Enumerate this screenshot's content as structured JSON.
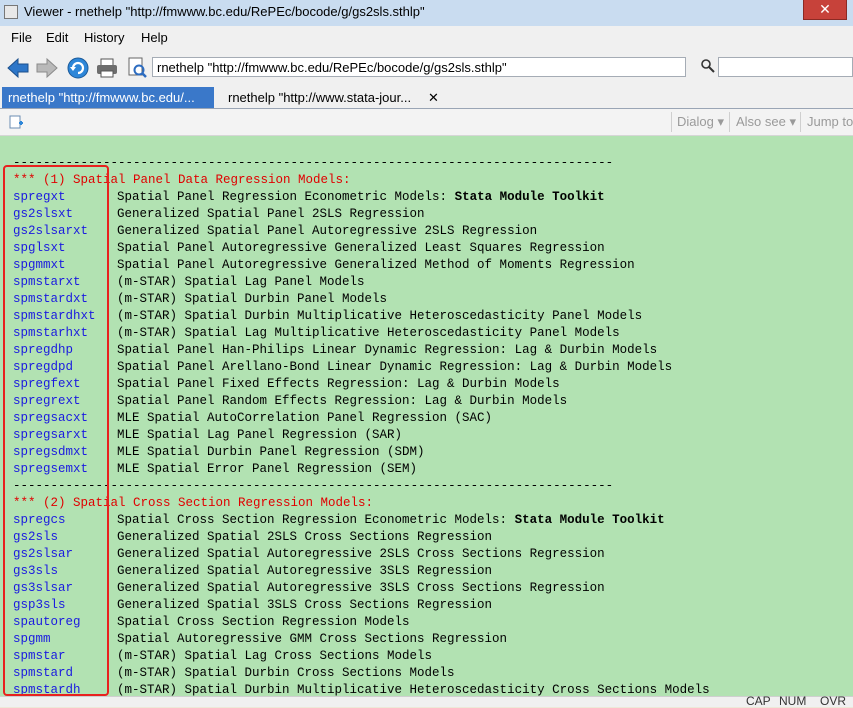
{
  "window": {
    "title": "Viewer - rnethelp \"http://fmwww.bc.edu/RePEc/bocode/g/gs2sls.sthlp\""
  },
  "menu": [
    "File",
    "Edit",
    "History",
    "Help"
  ],
  "toolbar": {
    "address": "rnethelp \"http://fmwww.bc.edu/RePEc/bocode/g/gs2sls.sthlp\""
  },
  "tabs": [
    {
      "label": "rnethelp \"http://fmwww.bc.edu/...",
      "active": true
    },
    {
      "label": "rnethelp \"http://www.stata-jour...",
      "active": false
    }
  ],
  "viewer_controls": {
    "dialog": "Dialog",
    "also_see": "Also see",
    "jump_to": "Jump to"
  },
  "content": {
    "rule": "--------------------------------------------------------------------------------",
    "section1": "*** (1) Spatial Panel Data Regression Models:",
    "section1_rows": [
      {
        "cmd": "spregxt",
        "desc": "Spatial Panel Regression Econometric Models: ",
        "bold": "Stata Module Toolkit"
      },
      {
        "cmd": "gs2slsxt",
        "desc": "Generalized Spatial Panel 2SLS Regression"
      },
      {
        "cmd": "gs2slsarxt",
        "desc": "Generalized Spatial Panel Autoregressive 2SLS Regression"
      },
      {
        "cmd": "spglsxt",
        "desc": "Spatial Panel Autoregressive Generalized Least Squares Regression"
      },
      {
        "cmd": "spgmmxt",
        "desc": "Spatial Panel Autoregressive Generalized Method of Moments Regression"
      },
      {
        "cmd": "spmstarxt",
        "desc": "(m-STAR) Spatial Lag Panel Models"
      },
      {
        "cmd": "spmstardxt",
        "desc": "(m-STAR) Spatial Durbin Panel Models"
      },
      {
        "cmd": "spmstardhxt",
        "desc": "(m-STAR) Spatial Durbin Multiplicative Heteroscedasticity Panel Models"
      },
      {
        "cmd": "spmstarhxt",
        "desc": "(m-STAR) Spatial Lag Multiplicative Heteroscedasticity Panel Models"
      },
      {
        "cmd": "spregdhp",
        "desc": "Spatial Panel Han-Philips Linear Dynamic Regression: Lag & Durbin Models"
      },
      {
        "cmd": "spregdpd",
        "desc": "Spatial Panel Arellano-Bond Linear Dynamic Regression: Lag & Durbin Models"
      },
      {
        "cmd": "spregfext",
        "desc": "Spatial Panel Fixed Effects Regression: Lag & Durbin Models"
      },
      {
        "cmd": "spregrext",
        "desc": "Spatial Panel Random Effects Regression: Lag & Durbin Models"
      },
      {
        "cmd": "spregsacxt",
        "desc": "MLE Spatial AutoCorrelation Panel Regression (SAC)"
      },
      {
        "cmd": "spregsarxt",
        "desc": "MLE Spatial Lag Panel Regression (SAR)"
      },
      {
        "cmd": "spregsdmxt",
        "desc": "MLE Spatial Durbin Panel Regression (SDM)"
      },
      {
        "cmd": "spregsemxt",
        "desc": "MLE Spatial Error Panel Regression (SEM)"
      }
    ],
    "section2": "*** (2) Spatial Cross Section Regression Models:",
    "section2_rows": [
      {
        "cmd": "spregcs",
        "desc": "Spatial Cross Section Regression Econometric Models: ",
        "bold": "Stata Module Toolkit"
      },
      {
        "cmd": "gs2sls",
        "desc": "Generalized Spatial 2SLS Cross Sections Regression"
      },
      {
        "cmd": "gs2slsar",
        "desc": "Generalized Spatial Autoregressive 2SLS Cross Sections Regression"
      },
      {
        "cmd": "gs3sls",
        "desc": "Generalized Spatial Autoregressive 3SLS Regression"
      },
      {
        "cmd": "gs3slsar",
        "desc": "Generalized Spatial Autoregressive 3SLS Cross Sections Regression"
      },
      {
        "cmd": "gsp3sls",
        "desc": "Generalized Spatial 3SLS Cross Sections Regression"
      },
      {
        "cmd": "spautoreg",
        "desc": "Spatial Cross Section Regression Models"
      },
      {
        "cmd": "spgmm",
        "desc": "Spatial Autoregressive GMM Cross Sections Regression"
      },
      {
        "cmd": "spmstar",
        "desc": "(m-STAR) Spatial Lag Cross Sections Models"
      },
      {
        "cmd": "spmstard",
        "desc": "(m-STAR) Spatial Durbin Cross Sections Models"
      },
      {
        "cmd": "spmstardh",
        "desc": "(m-STAR) Spatial Durbin Multiplicative Heteroscedasticity Cross Sections Models"
      }
    ]
  },
  "status": {
    "cap": "CAP",
    "num": "NUM",
    "ovr": "OVR"
  },
  "colors": {
    "content_bg": "#b2e2b2",
    "link": "#1a1ae0",
    "header": "#e00000",
    "highlight_box": "#e8211e"
  }
}
